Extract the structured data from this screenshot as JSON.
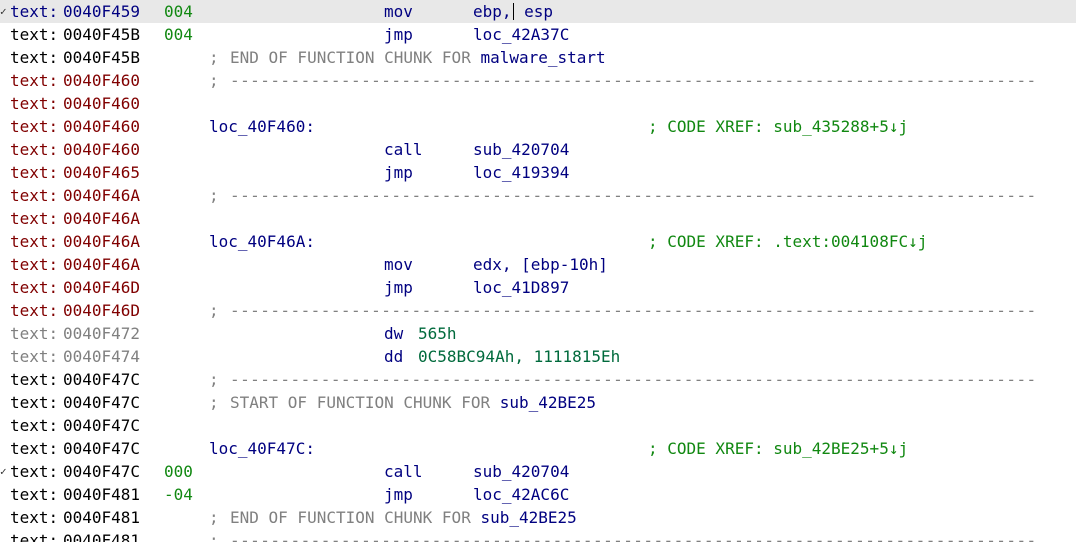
{
  "colors": {
    "address_blue": "#000080",
    "address_black": "#000000",
    "address_maroon": "#800000",
    "address_gray": "#808080",
    "code": "#000080",
    "comment": "#808080",
    "xref": "#118811",
    "data_operand": "#006a3c",
    "highlight_row": "#e8e8e8"
  },
  "lines": [
    {
      "kind": "instr",
      "mark": "✓",
      "seg": "text:",
      "addr": "0040F459",
      "addr_color": "blue",
      "stack": "004",
      "mnem": "mov",
      "ops_pre": "ebp,",
      "ops_post": " esp",
      "highlight": true
    },
    {
      "kind": "instr",
      "seg": "text:",
      "addr": "0040F45B",
      "addr_color": "black",
      "stack": "004",
      "mnem": "jmp",
      "ops": "loc_42A37C"
    },
    {
      "kind": "comment",
      "seg": "text:",
      "addr": "0040F45B",
      "addr_color": "black",
      "comment": "END OF FUNCTION CHUNK FOR ",
      "func": "malware_start"
    },
    {
      "kind": "sep",
      "seg": "text:",
      "addr": "0040F460",
      "addr_color": "maroon"
    },
    {
      "kind": "blank",
      "seg": "text:",
      "addr": "0040F460",
      "addr_color": "maroon"
    },
    {
      "kind": "label",
      "seg": "text:",
      "addr": "0040F460",
      "addr_color": "maroon",
      "label": "loc_40F460:",
      "xref": "; CODE XREF: sub_435288+5↓j"
    },
    {
      "kind": "instr",
      "seg": "text:",
      "addr": "0040F460",
      "addr_color": "maroon",
      "mnem": "call",
      "ops": "sub_420704"
    },
    {
      "kind": "instr",
      "seg": "text:",
      "addr": "0040F465",
      "addr_color": "maroon",
      "mnem": "jmp",
      "ops": "loc_419394"
    },
    {
      "kind": "sep",
      "seg": "text:",
      "addr": "0040F46A",
      "addr_color": "maroon"
    },
    {
      "kind": "blank",
      "seg": "text:",
      "addr": "0040F46A",
      "addr_color": "maroon"
    },
    {
      "kind": "label",
      "seg": "text:",
      "addr": "0040F46A",
      "addr_color": "maroon",
      "label": "loc_40F46A:",
      "xref": "; CODE XREF: .text:004108FC↓j"
    },
    {
      "kind": "instr",
      "seg": "text:",
      "addr": "0040F46A",
      "addr_color": "maroon",
      "mnem": "mov",
      "ops": "edx, [ebp-10h]"
    },
    {
      "kind": "instr",
      "seg": "text:",
      "addr": "0040F46D",
      "addr_color": "maroon",
      "mnem": "jmp",
      "ops": "loc_41D897"
    },
    {
      "kind": "sep",
      "seg": "text:",
      "addr": "0040F46D",
      "addr_color": "maroon"
    },
    {
      "kind": "data",
      "seg": "text:",
      "addr": "0040F472",
      "addr_color": "gray",
      "mnem": "dw",
      "dataops": "565h"
    },
    {
      "kind": "data",
      "seg": "text:",
      "addr": "0040F474",
      "addr_color": "gray",
      "mnem": "dd",
      "dataops": "0C58BC94Ah, 1111815Eh"
    },
    {
      "kind": "sep",
      "seg": "text:",
      "addr": "0040F47C",
      "addr_color": "black"
    },
    {
      "kind": "comment",
      "seg": "text:",
      "addr": "0040F47C",
      "addr_color": "black",
      "comment": "START OF FUNCTION CHUNK FOR ",
      "func": "sub_42BE25"
    },
    {
      "kind": "blank",
      "seg": "text:",
      "addr": "0040F47C",
      "addr_color": "black"
    },
    {
      "kind": "label",
      "seg": "text:",
      "addr": "0040F47C",
      "addr_color": "black",
      "label": "loc_40F47C:",
      "xref": "; CODE XREF: sub_42BE25+5↓j"
    },
    {
      "kind": "instr",
      "mark": "✓",
      "seg": "text:",
      "addr": "0040F47C",
      "addr_color": "black",
      "stack": "000",
      "mnem": "call",
      "ops": "sub_420704"
    },
    {
      "kind": "instr",
      "seg": "text:",
      "addr": "0040F481",
      "addr_color": "black",
      "stack": "-04",
      "mnem": "jmp",
      "ops": "loc_42AC6C"
    },
    {
      "kind": "comment",
      "seg": "text:",
      "addr": "0040F481",
      "addr_color": "black",
      "comment": "END OF FUNCTION CHUNK FOR ",
      "func": "sub_42BE25"
    },
    {
      "kind": "sep",
      "seg": "text:",
      "addr": "0040F481",
      "addr_color": "black"
    }
  ]
}
